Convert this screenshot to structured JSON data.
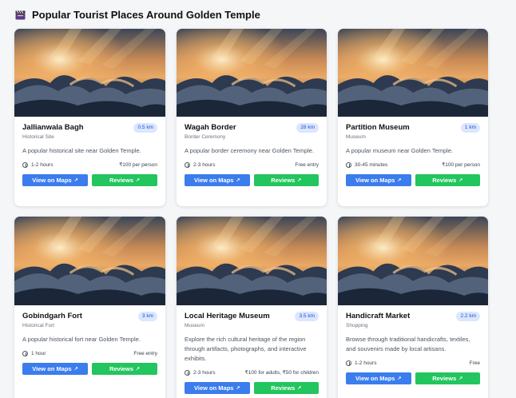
{
  "header": {
    "title": "Popular Tourist Places Around Golden Temple",
    "icon": "clapperboard-icon"
  },
  "colors": {
    "maps_button": "#3b7ded",
    "reviews_button": "#22c55e",
    "badge_bg": "#dbe7fd",
    "badge_text": "#1d4ed8"
  },
  "cards": [
    {
      "title": "Jallianwala Bagh",
      "distance": "0.5 km",
      "category": "Historical Site",
      "description": "A popular historical site near Golden Temple.",
      "duration": "1-2 hours",
      "price": "₹100 per person",
      "maps_label": "View on Maps",
      "reviews_label": "Reviews"
    },
    {
      "title": "Wagah Border",
      "distance": "28 km",
      "category": "Border Ceremony",
      "description": "A popular border ceremony near Golden Temple.",
      "duration": "2-3 hours",
      "price": "Free entry",
      "maps_label": "View on Maps",
      "reviews_label": "Reviews"
    },
    {
      "title": "Partition Museum",
      "distance": "1 km",
      "category": "Museum",
      "description": "A popular museum near Golden Temple.",
      "duration": "30-45 minutes",
      "price": "₹100 per person",
      "maps_label": "View on Maps",
      "reviews_label": "Reviews"
    },
    {
      "title": "Gobindgarh Fort",
      "distance": "3 km",
      "category": "Historical Fort",
      "description": "A popular historical fort near Golden Temple.",
      "duration": "1 hour",
      "price": "Free entry",
      "maps_label": "View on Maps",
      "reviews_label": "Reviews"
    },
    {
      "title": "Local Heritage Museum",
      "distance": "3.5 km",
      "category": "Museum",
      "description": "Explore the rich cultural heritage of the region through artifacts, photographs, and interactive exhibits.",
      "duration": "2-3 hours",
      "price": "₹100 for adults, ₹50 for children",
      "maps_label": "View on Maps",
      "reviews_label": "Reviews"
    },
    {
      "title": "Handicraft Market",
      "distance": "2.2 km",
      "category": "Shopping",
      "description": "Browse through traditional handicrafts, textiles, and souvenirs made by local artisans.",
      "duration": "1-2 hours",
      "price": "Free",
      "maps_label": "View on Maps",
      "reviews_label": "Reviews"
    }
  ]
}
